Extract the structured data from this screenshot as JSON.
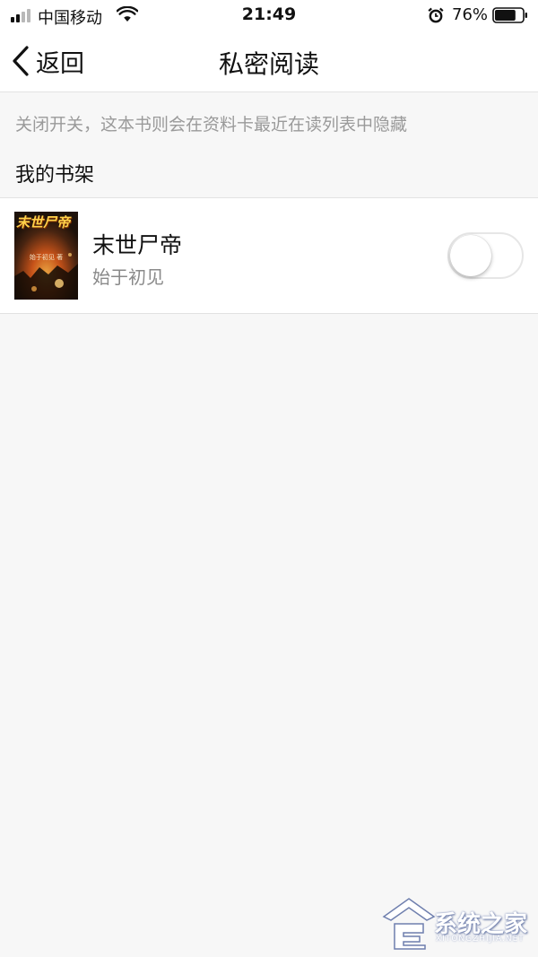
{
  "status_bar": {
    "carrier": "中国移动",
    "time": "21:49",
    "battery_percent": "76%",
    "battery_level": 0.76,
    "signal_bars_filled": 2,
    "signal_bars_total": 4
  },
  "nav": {
    "back_label": "返回",
    "title": "私密阅读"
  },
  "hint": "关闭开关，这本书则会在资料卡最近在读列表中隐藏",
  "section_title": "我的书架",
  "books": [
    {
      "title": "末世尸帝",
      "author": "始于初见",
      "cover_title": "末世尸帝",
      "cover_author": "始于初见 著",
      "private_enabled": false
    }
  ],
  "watermark": {
    "text": "系统之家",
    "sub": "XITONGZHIJIA.NET"
  },
  "colors": {
    "background": "#f7f7f7",
    "surface": "#ffffff",
    "divider": "#e2e2e2",
    "hint_text": "#9a9a9a",
    "secondary_text": "#8a8a8a"
  }
}
